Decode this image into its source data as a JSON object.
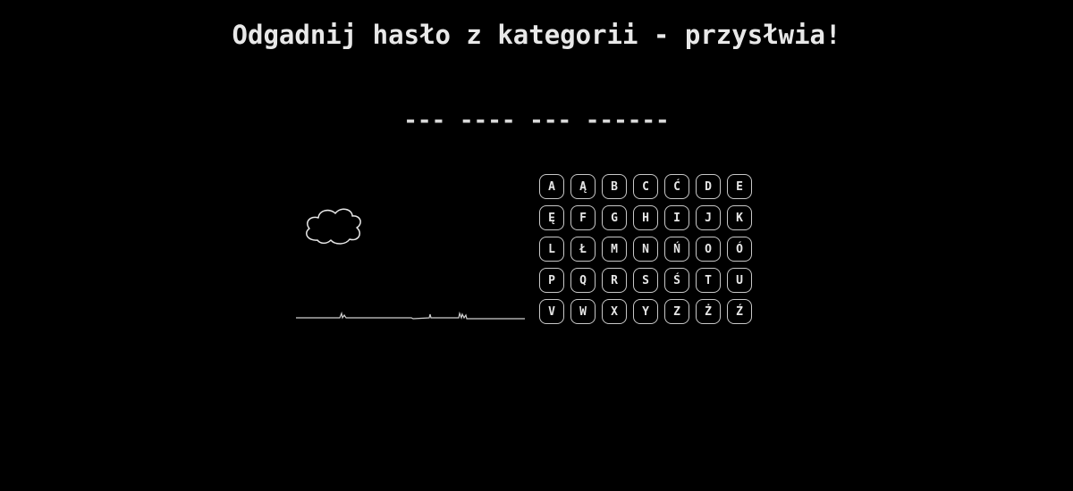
{
  "header": {
    "title": "Odgadnij hasło z kategorii - przysłwia!"
  },
  "puzzle": {
    "masked_phrase": "--- ---- --- ------"
  },
  "keyboard": {
    "letters": [
      "A",
      "Ą",
      "B",
      "C",
      "Ć",
      "D",
      "E",
      "Ę",
      "F",
      "G",
      "H",
      "I",
      "J",
      "K",
      "L",
      "Ł",
      "M",
      "N",
      "Ń",
      "O",
      "Ó",
      "P",
      "Q",
      "R",
      "S",
      "Ś",
      "T",
      "U",
      "V",
      "W",
      "X",
      "Y",
      "Z",
      "Ż",
      "Ź"
    ]
  },
  "scene": {
    "elements": [
      "cloud-icon",
      "grass-ground-line"
    ]
  },
  "colors": {
    "background": "#000000",
    "text": "#e6e6e6",
    "key_border": "#c8c8c8"
  }
}
